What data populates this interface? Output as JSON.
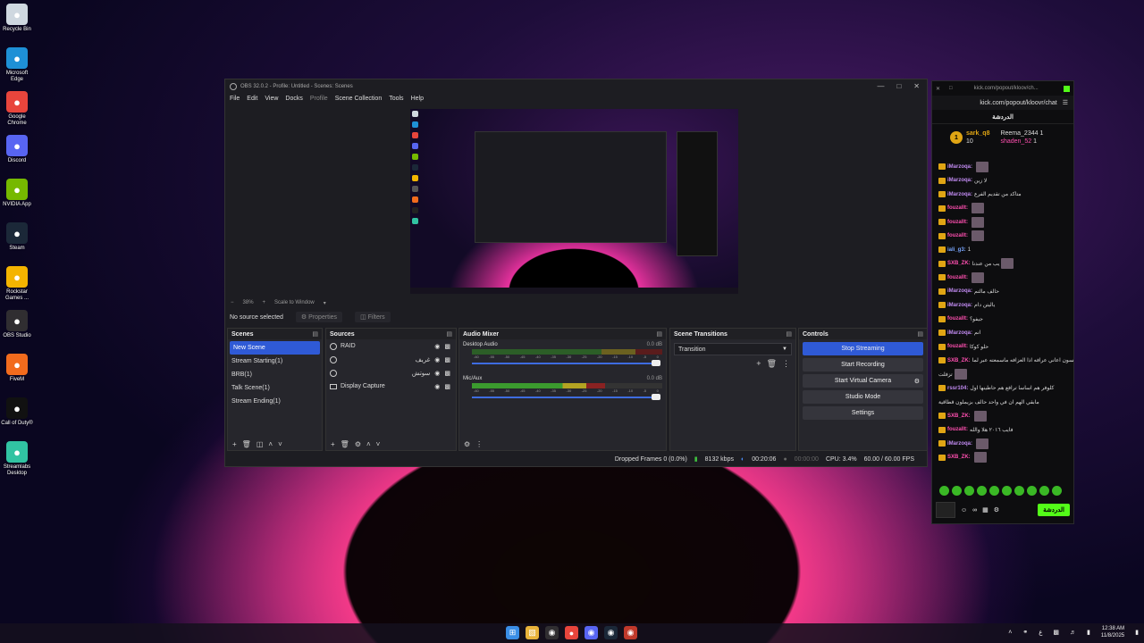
{
  "desktop": {
    "icons": [
      {
        "label": "Recycle Bin",
        "icon": "recycle-bin-icon",
        "color": "#cfd8e0"
      },
      {
        "label": "Microsoft Edge",
        "icon": "edge-icon",
        "color": "#1e90d6"
      },
      {
        "label": "Google Chrome",
        "icon": "chrome-icon",
        "color": "#e8453c"
      },
      {
        "label": "Discord",
        "icon": "discord-icon",
        "color": "#5865f2"
      },
      {
        "label": "NVIDIA App",
        "icon": "nvidia-icon",
        "color": "#76b900"
      },
      {
        "label": "Steam",
        "icon": "steam-icon",
        "color": "#1b2838"
      },
      {
        "label": "Rockstar Games ...",
        "icon": "rockstar-icon",
        "color": "#f4b400"
      },
      {
        "label": "OBS Studio",
        "icon": "obs-icon",
        "color": "#302e31"
      },
      {
        "label": "FiveM",
        "icon": "fivem-icon",
        "color": "#f26b1d"
      },
      {
        "label": "Call of Duty®",
        "icon": "cod-icon",
        "color": "#111111"
      },
      {
        "label": "Streamlabs Desktop",
        "icon": "streamlabs-icon",
        "color": "#31c3a2"
      }
    ]
  },
  "obs": {
    "title": "OBS 32.0.2 - Profile: Untitled - Scenes: Scenes",
    "menu": [
      "File",
      "Edit",
      "View",
      "Docks",
      "Profile",
      "Scene Collection",
      "Tools",
      "Help"
    ],
    "zoom": "38%",
    "scale_label": "Scale to Window",
    "source_status": "No source selected",
    "properties_label": "Properties",
    "filters_label": "Filters",
    "scenes": {
      "title": "Scenes",
      "items": [
        "New Scene",
        "Stream Starting(1)",
        "BRB(1)",
        "Talk Scene(1)",
        "Stream Ending(1)"
      ]
    },
    "sources": {
      "title": "Sources",
      "items": [
        "RAID",
        "غريف",
        "سوتش",
        "Display Capture"
      ]
    },
    "mixer": {
      "title": "Audio Mixer",
      "tracks": [
        {
          "name": "Desktop Audio",
          "db": "0.0 dB",
          "level": 0.0
        },
        {
          "name": "Mic/Aux",
          "db": "0.0 dB",
          "level": 0.7
        }
      ],
      "ticks": [
        "-60",
        "-55",
        "-50",
        "-45",
        "-40",
        "-35",
        "-30",
        "-25",
        "-20",
        "-15",
        "-10",
        "-5",
        "0"
      ]
    },
    "transitions": {
      "title": "Scene Transitions",
      "selected": "Transition"
    },
    "controls": {
      "title": "Controls",
      "buttons": [
        "Stop Streaming",
        "Start Recording",
        "Start Virtual Camera",
        "Studio Mode",
        "Settings"
      ]
    },
    "status": {
      "dropped": "Dropped Frames 0 (0.0%)",
      "bitrate": "8132 kbps",
      "stream_time": "00:20:06",
      "rec_time": "00:00:00",
      "cpu": "CPU: 3.4%",
      "fps": "60.00 / 60.00 FPS"
    }
  },
  "chat": {
    "url": "kick.com/popout/kloov/ch...",
    "url_full": "kick.com/popout/kloovr/chat",
    "header": "الدردشة",
    "leaders": [
      {
        "rank": "1",
        "name": "sark_q8",
        "count": "10",
        "name2": "Reema_2344",
        "count2": "1",
        "name3": "shaden_52",
        "count3": "1"
      }
    ],
    "messages": [
      {
        "user": "iMarzoqa:",
        "text": "",
        "color": "#c08af0",
        "emote": true
      },
      {
        "user": "iMarzoqa:",
        "text": "لا زين",
        "color": "#c08af0",
        "emote": false
      },
      {
        "user": "iMarzoqa:",
        "text": "متاكد من تقديم الفرع",
        "color": "#c08af0",
        "emote": false
      },
      {
        "user": "fouzallt:",
        "text": "",
        "color": "#ff4fb0",
        "emote": true
      },
      {
        "user": "fouzallt:",
        "text": "",
        "color": "#ff4fb0",
        "emote": true
      },
      {
        "user": "fouzallt:",
        "text": "",
        "color": "#ff4fb0",
        "emote": true
      },
      {
        "user": "iali_g3:",
        "text": "1",
        "color": "#7aa7ff",
        "emote": false
      },
      {
        "user": "SXB_ZK:",
        "text": "يب من عندنا",
        "color": "#ff4fb0",
        "emote": true
      },
      {
        "user": "fouzallt:",
        "text": "",
        "color": "#ff4fb0",
        "emote": true
      },
      {
        "user": "iMarzoqa:",
        "text": "حالف مالتم",
        "color": "#c08af0",
        "emote": false
      },
      {
        "user": "iMarzoqa:",
        "text": "ياليتن دام",
        "color": "#c08af0",
        "emote": false
      },
      {
        "user": "fouzallt:",
        "text": "جيفو؟",
        "color": "#ff4fb0",
        "emote": false
      },
      {
        "user": "iMarzoqa:",
        "text": "انم",
        "color": "#c08af0",
        "emote": false
      },
      {
        "user": "fouzallt:",
        "text": "حلو كوكا",
        "color": "#ff4fb0",
        "emote": false
      },
      {
        "user": "SXB_ZK:",
        "text": "عسعسون اعاني عرافه اذا العزافه ماسمعته عبر لما",
        "color": "#ff4fb0",
        "emote": false
      },
      {
        "user": "",
        "text": "تزفلت",
        "color": "#ddd",
        "emote": true
      },
      {
        "user": "rssr104:",
        "text": "كلوفر هم اساسا ترافع هم حاطينها اول",
        "color": "#c08af0",
        "emote": false
      },
      {
        "user": "",
        "text": "مابقي الهم ان في واحد حالف بزيملون قطاقية",
        "color": "#ddd",
        "emote": false
      },
      {
        "user": "SXB_ZK:",
        "text": "",
        "color": "#ff4fb0",
        "emote": true
      },
      {
        "user": "fouzallt:",
        "text": "فايب ٢٠١٦ هلا والله",
        "color": "#ff4fb0",
        "emote": false
      },
      {
        "user": "iMarzoqa:",
        "text": "",
        "color": "#c08af0",
        "emote": true
      },
      {
        "user": "SXB_ZK:",
        "text": "",
        "color": "#ff4fb0",
        "emote": true
      }
    ],
    "send_label": "الدردشة",
    "colors": {
      "accent": "#53fc18",
      "badge": "#e0a514"
    }
  },
  "taskbar": {
    "apps": [
      "start-icon",
      "file-explorer-icon",
      "obs-icon",
      "chrome-icon",
      "discord-icon",
      "steam-icon",
      "game-icon"
    ],
    "lang": "ع",
    "time": "12:38 AM",
    "date": "11/8/2025"
  }
}
